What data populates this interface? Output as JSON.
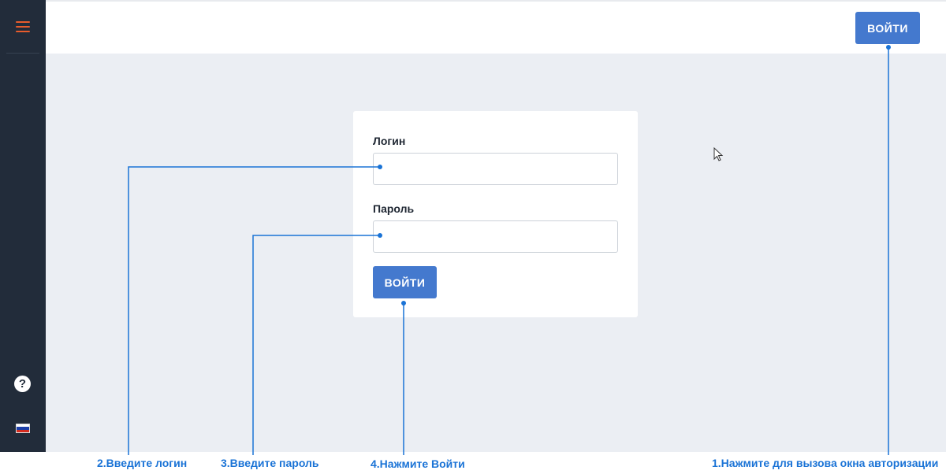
{
  "sidebar": {
    "menu_icon": "hamburger-menu-icon",
    "help_icon": "question-circle-icon",
    "help_glyph": "?",
    "language_icon": "russian-flag-icon",
    "flag_colors": [
      "#ffffff",
      "#1c3fa8",
      "#d52b1e"
    ]
  },
  "header": {
    "login_button": "ВОЙТИ"
  },
  "login_form": {
    "login_label": "Логин",
    "login_value": "",
    "password_label": "Пароль",
    "password_value": "",
    "submit_button": "ВОЙТИ"
  },
  "annotations": {
    "step1": "1.Нажмите для вызова окна авторизации",
    "step2": "2.Введите логин",
    "step3": "3.Введите пароль",
    "step4": "4.Нажмите Войти"
  },
  "colors": {
    "accent": "#4479ce",
    "sidebar_bg": "#222c3a",
    "menu_icon": "#e85c2c",
    "page_bg": "#ebeef3",
    "annotation": "#1a73d6"
  }
}
